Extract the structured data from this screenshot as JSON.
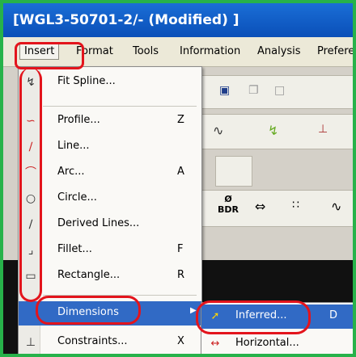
{
  "window": {
    "title": "[WGL3-50701-2/- (Modified) ]"
  },
  "menubar": {
    "items": [
      "Insert",
      "Format",
      "Tools",
      "Information",
      "Analysis",
      "Prefere"
    ]
  },
  "toolbar": {
    "dimension_button_label": "BDR"
  },
  "insert_menu": {
    "items": [
      {
        "label": "Fit Spline...",
        "shortcut": "",
        "icon": "fit-spline-icon"
      },
      {
        "label": "Profile...",
        "shortcut": "Z",
        "icon": "profile-icon"
      },
      {
        "label": "Line...",
        "shortcut": "",
        "icon": "line-icon"
      },
      {
        "label": "Arc...",
        "shortcut": "A",
        "icon": "arc-icon"
      },
      {
        "label": "Circle...",
        "shortcut": "",
        "icon": "circle-icon"
      },
      {
        "label": "Derived Lines...",
        "shortcut": "",
        "icon": "derived-lines-icon"
      },
      {
        "label": "Fillet...",
        "shortcut": "F",
        "icon": "fillet-icon"
      },
      {
        "label": "Rectangle...",
        "shortcut": "R",
        "icon": "rectangle-icon"
      },
      {
        "label": "Dimensions",
        "shortcut": "",
        "icon": ""
      },
      {
        "label": "Constraints...",
        "shortcut": "X",
        "icon": "constraints-icon"
      }
    ]
  },
  "dimensions_submenu": {
    "items": [
      {
        "label": "Inferred...",
        "shortcut": "D",
        "icon": "inferred-dimension-icon"
      },
      {
        "label": "Horizontal...",
        "shortcut": "",
        "icon": "horizontal-dimension-icon"
      }
    ]
  },
  "colors": {
    "frame": "#27b24a",
    "title_bar": "#0a4fb8",
    "highlight": "#316ac5",
    "annotation": "#e3141c"
  }
}
